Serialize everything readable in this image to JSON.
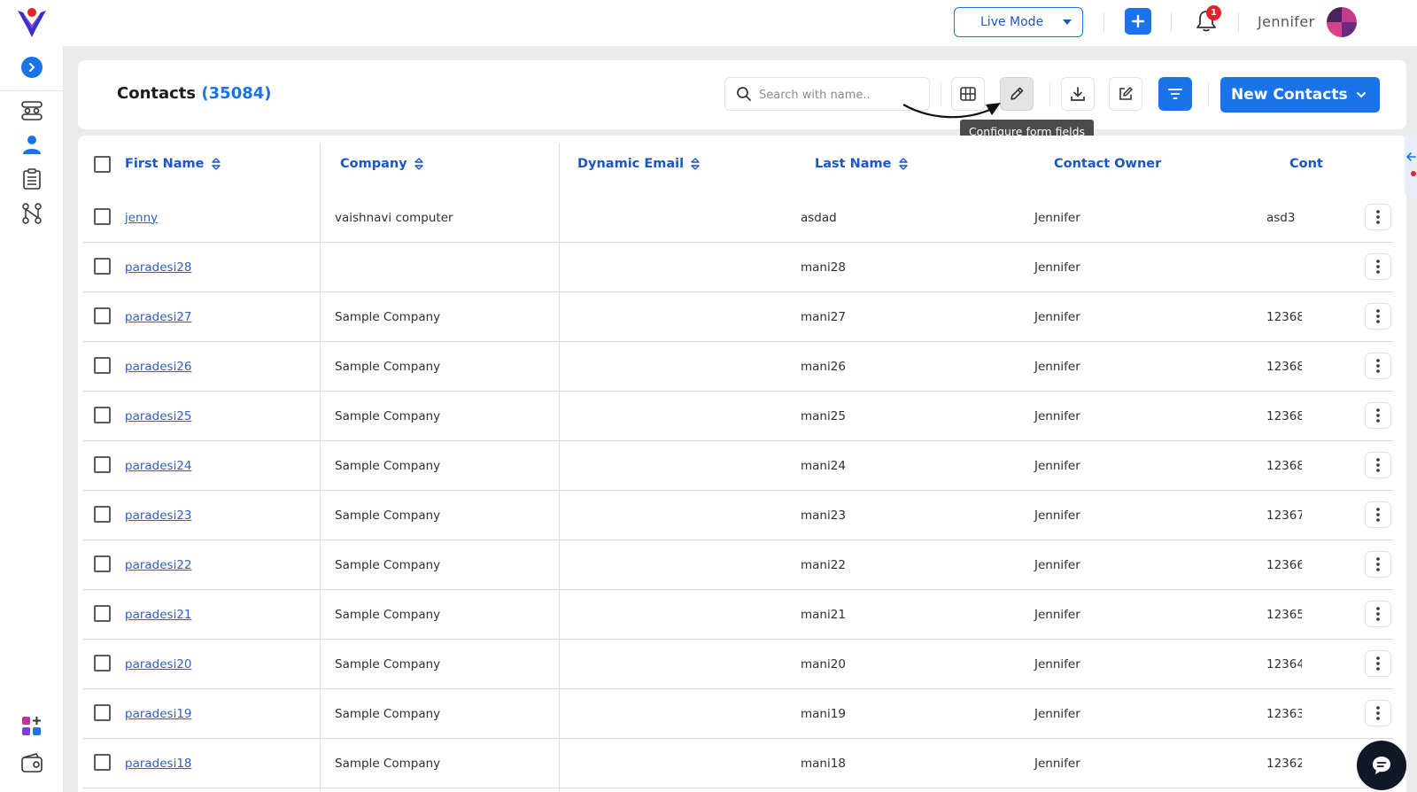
{
  "topbar": {
    "mode_label": "Live Mode",
    "notification_count": "1",
    "user_name": "Jennifer"
  },
  "header": {
    "title": "Contacts",
    "count": "(35084)",
    "search_placeholder": "Search with name..",
    "tooltip": "Configure form fields",
    "new_button": "New Contacts"
  },
  "table": {
    "columns": [
      "First Name",
      "Company",
      "Dynamic Email",
      "Last Name",
      "Contact Owner",
      "Cont"
    ],
    "rows": [
      {
        "first": "jenny",
        "company": "vaishnavi computer",
        "email": "",
        "last": "asdad",
        "owner": "Jennifer",
        "contact": "asd3"
      },
      {
        "first": "paradesi28",
        "company": "",
        "email": "",
        "last": "mani28",
        "owner": "Jennifer",
        "contact": ""
      },
      {
        "first": "paradesi27",
        "company": "Sample Company",
        "email": "",
        "last": "mani27",
        "owner": "Jennifer",
        "contact": "12368"
      },
      {
        "first": "paradesi26",
        "company": "Sample Company",
        "email": "",
        "last": "mani26",
        "owner": "Jennifer",
        "contact": "12368"
      },
      {
        "first": "paradesi25",
        "company": "Sample Company",
        "email": "",
        "last": "mani25",
        "owner": "Jennifer",
        "contact": "12368"
      },
      {
        "first": "paradesi24",
        "company": "Sample Company",
        "email": "",
        "last": "mani24",
        "owner": "Jennifer",
        "contact": "12368"
      },
      {
        "first": "paradesi23",
        "company": "Sample Company",
        "email": "",
        "last": "mani23",
        "owner": "Jennifer",
        "contact": "12367"
      },
      {
        "first": "paradesi22",
        "company": "Sample Company",
        "email": "",
        "last": "mani22",
        "owner": "Jennifer",
        "contact": "12366"
      },
      {
        "first": "paradesi21",
        "company": "Sample Company",
        "email": "",
        "last": "mani21",
        "owner": "Jennifer",
        "contact": "12365"
      },
      {
        "first": "paradesi20",
        "company": "Sample Company",
        "email": "",
        "last": "mani20",
        "owner": "Jennifer",
        "contact": "12364"
      },
      {
        "first": "paradesi19",
        "company": "Sample Company",
        "email": "",
        "last": "mani19",
        "owner": "Jennifer",
        "contact": "12363"
      },
      {
        "first": "paradesi18",
        "company": "Sample Company",
        "email": "",
        "last": "mani18",
        "owner": "Jennifer",
        "contact": "12362"
      }
    ]
  },
  "colors": {
    "primary": "#1a73e8",
    "link": "#2a62c9",
    "badge": "#e8202a",
    "tooltip_bg": "#4b4b4b",
    "chat_bg": "#101828"
  },
  "icons": {
    "sidebar": [
      "workflow-icon",
      "contact-person-icon",
      "clipboard-list-icon",
      "integration-tree-icon",
      "apps-add-icon",
      "wallet-icon"
    ],
    "toolbar": [
      "columns-icon",
      "pencil-icon",
      "download-icon",
      "edit-square-icon",
      "filter-icon"
    ]
  }
}
